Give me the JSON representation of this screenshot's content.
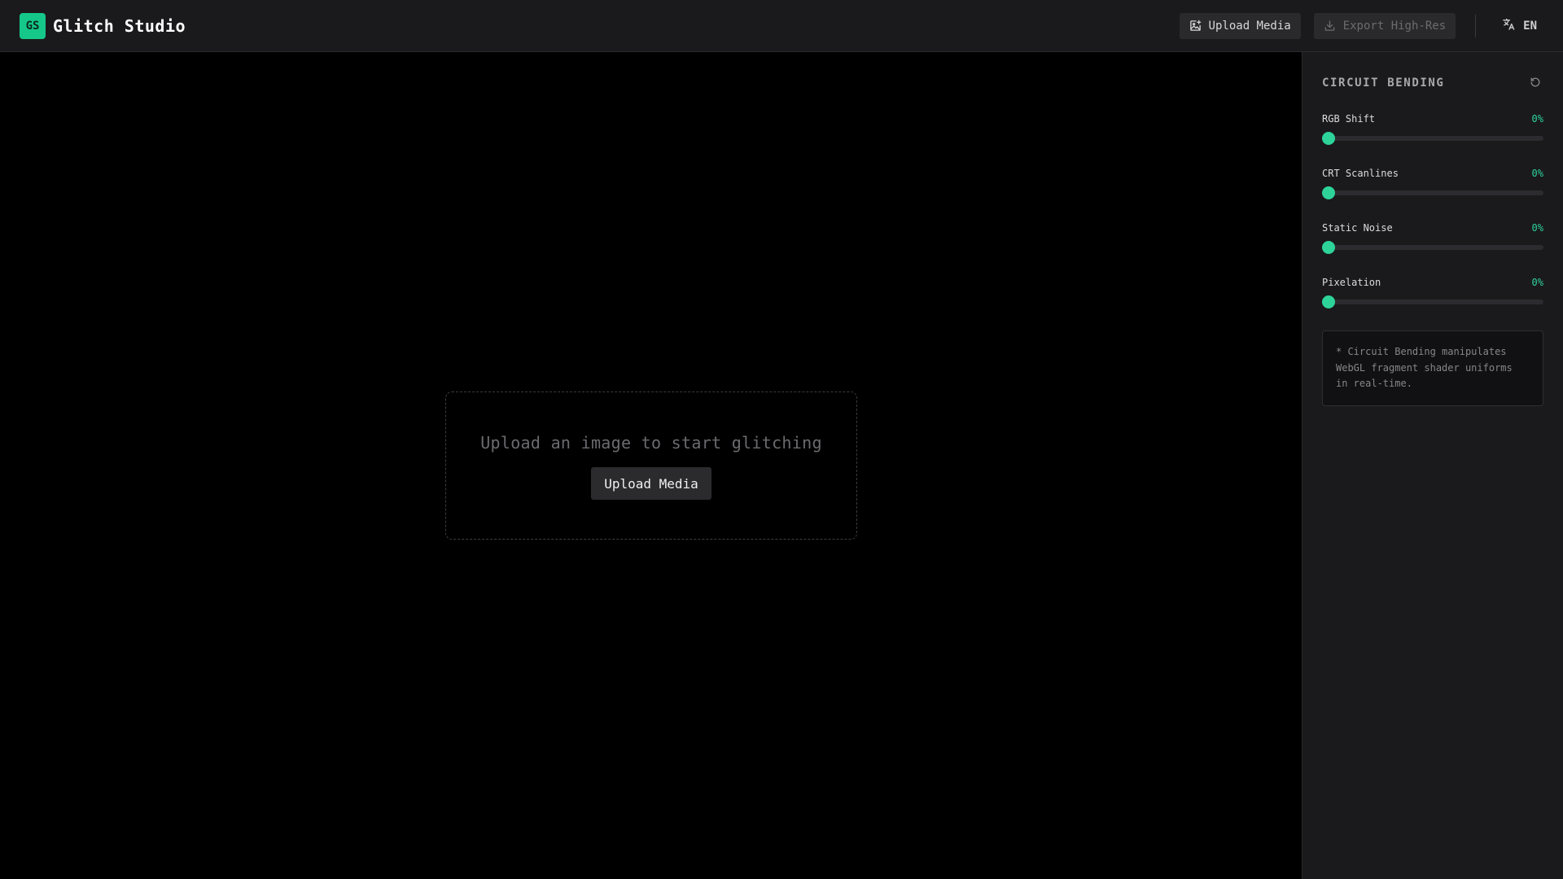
{
  "header": {
    "logo_text": "GS",
    "app_title": "Glitch Studio",
    "upload_label": "Upload Media",
    "export_label": "Export High-Res",
    "language": "EN"
  },
  "canvas": {
    "empty_text": "Upload an image to start glitching",
    "upload_label": "Upload Media"
  },
  "panel": {
    "title": "CIRCUIT BENDING",
    "sliders": [
      {
        "label": "RGB Shift",
        "value": 0,
        "display": "0%"
      },
      {
        "label": "CRT Scanlines",
        "value": 0,
        "display": "0%"
      },
      {
        "label": "Static Noise",
        "value": 0,
        "display": "0%"
      },
      {
        "label": "Pixelation",
        "value": 0,
        "display": "0%"
      }
    ],
    "note": "* Circuit Bending manipulates WebGL fragment shader uniforms in real-time."
  },
  "colors": {
    "accent": "#15c88a",
    "accent_text": "#2ed39a",
    "panel_bg": "#1a1a1c",
    "canvas_bg": "#000000"
  },
  "icons": {
    "upload": "image-plus-icon",
    "export": "download-icon",
    "language": "translate-icon",
    "reset": "reset-icon"
  }
}
